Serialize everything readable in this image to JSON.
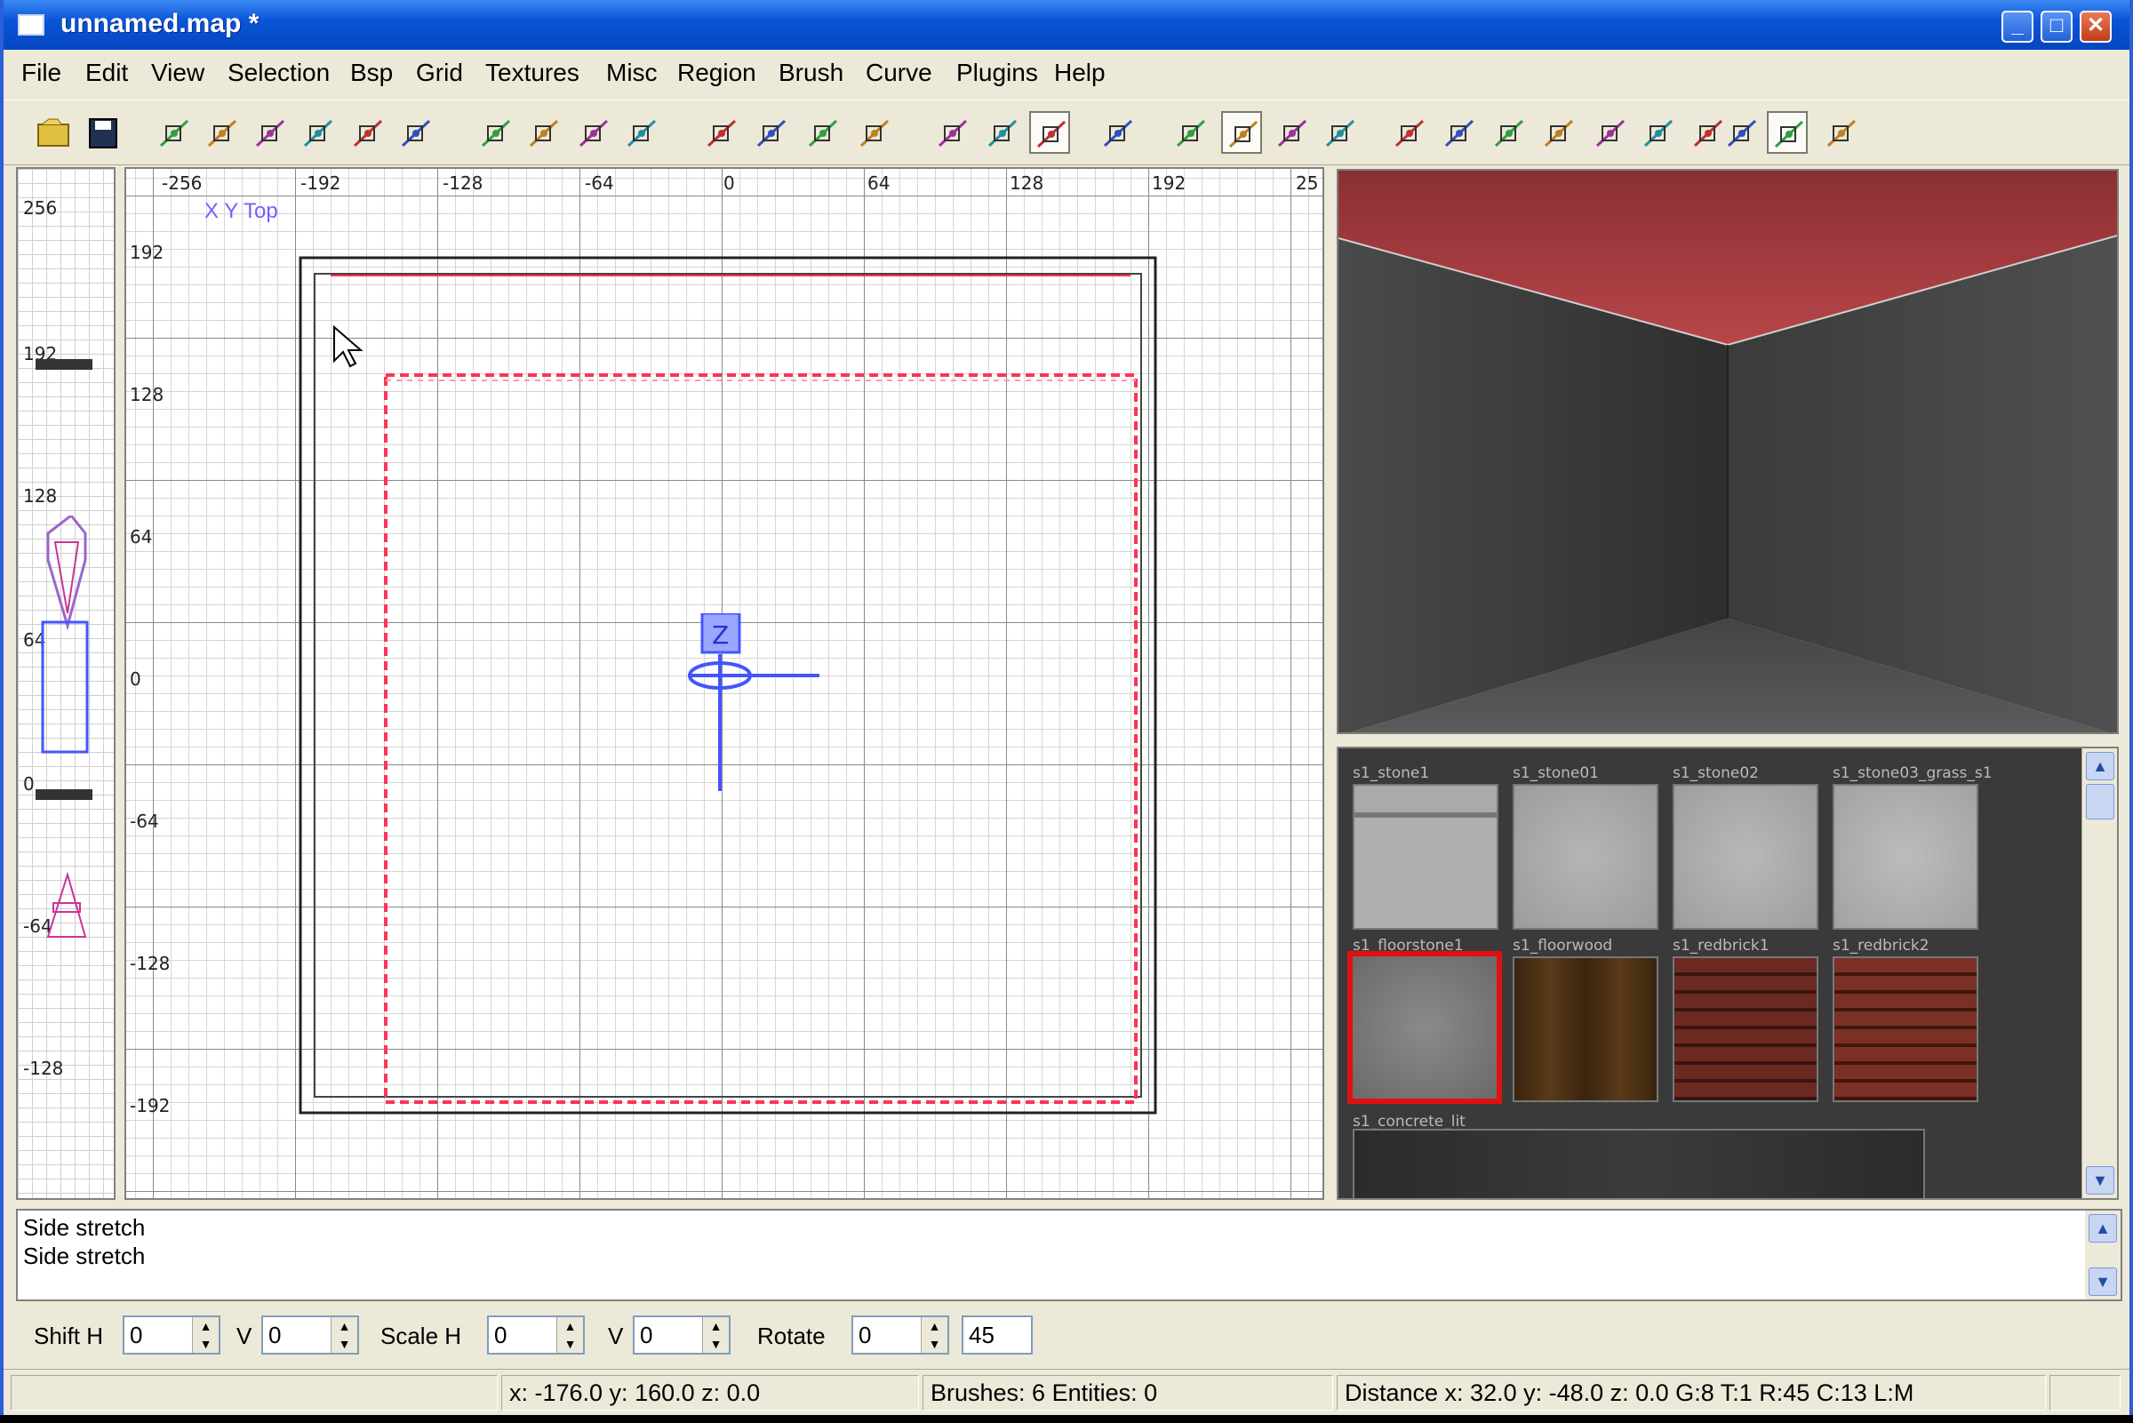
{
  "window": {
    "title": "unnamed.map *",
    "controls": {
      "minimize": "_",
      "maximize": "□",
      "close": "✕"
    }
  },
  "menu": [
    "File",
    "Edit",
    "View",
    "Selection",
    "Bsp",
    "Grid",
    "Textures",
    "Misc",
    "Region",
    "Brush",
    "Curve",
    "Plugins",
    "Help"
  ],
  "toolbar": {
    "icons": [
      "open-icon",
      "save-icon",
      "flip-x-icon",
      "rotate-x-icon",
      "flip-y-icon",
      "rotate-y-icon",
      "flip-z-icon",
      "rotate-z-icon",
      "select-complete-tall-icon",
      "select-touching-icon",
      "select-partial-tall-icon",
      "select-inside-icon",
      "csg-subtract-icon",
      "csg-merge-icon",
      "hollow-icon",
      "clipper-icon",
      "change-views-icon",
      "texture-lock-icon",
      "cubic-clipping-icon",
      "camera-lighting-icon",
      "entities-as-box-icon",
      "patch-icon",
      "scale-x-icon",
      "scale-y-icon",
      "scale-z-icon",
      "free-rotation-icon",
      "drag-edges-icon",
      "drag-vertices-icon",
      "patch-bend-icon",
      "patch-insert-icon",
      "patch-tesselation-icon",
      "select-faces-icon",
      "select-edges-icon",
      "plugin-icon"
    ]
  },
  "xy_view": {
    "title": "X Y Top",
    "x_ticks": [
      "-256",
      "-192",
      "-128",
      "-64",
      "0",
      "64",
      "128",
      "192",
      "25"
    ],
    "y_ticks": [
      "192",
      "128",
      "64",
      "0",
      "-64",
      "-128",
      "-192"
    ]
  },
  "z_view": {
    "ticks": [
      "256",
      "192",
      "128",
      "64",
      "0",
      "-64",
      "-128"
    ]
  },
  "texture_browser": {
    "labels_row1": [
      "s1_stone1",
      "s1_stone01",
      "s1_stone02",
      "s1_stone03_grass_s1"
    ],
    "labels_row2": [
      "s1_floorstone1",
      "s1_floorwood",
      "s1_redbrick1",
      "s1_redbrick2"
    ],
    "label_row3": "s1_concrete_lit"
  },
  "console": {
    "lines": [
      "Side stretch",
      "Side stretch"
    ]
  },
  "inspector": {
    "shift_h_label": "Shift H",
    "shift_h": "0",
    "v1_label": "V",
    "v1": "0",
    "scale_h_label": "Scale H",
    "scale_h": "0",
    "v2_label": "V",
    "v2": "0",
    "rotate_label": "Rotate",
    "rotate": "0",
    "angle": "45"
  },
  "status": {
    "coords": "x: -176.0  y: 160.0  z: 0.0",
    "counts": "Brushes: 6 Entities: 0",
    "distance": "Distance x: 32.0  y: -48.0  z: 0.0 G:8 T:1 R:45 C:13 L:M"
  },
  "colors": {
    "title_bar": "#0a55d8",
    "selection_red": "#ff3355",
    "entity_blue": "#4455ff",
    "brush_dark": "#333333"
  }
}
